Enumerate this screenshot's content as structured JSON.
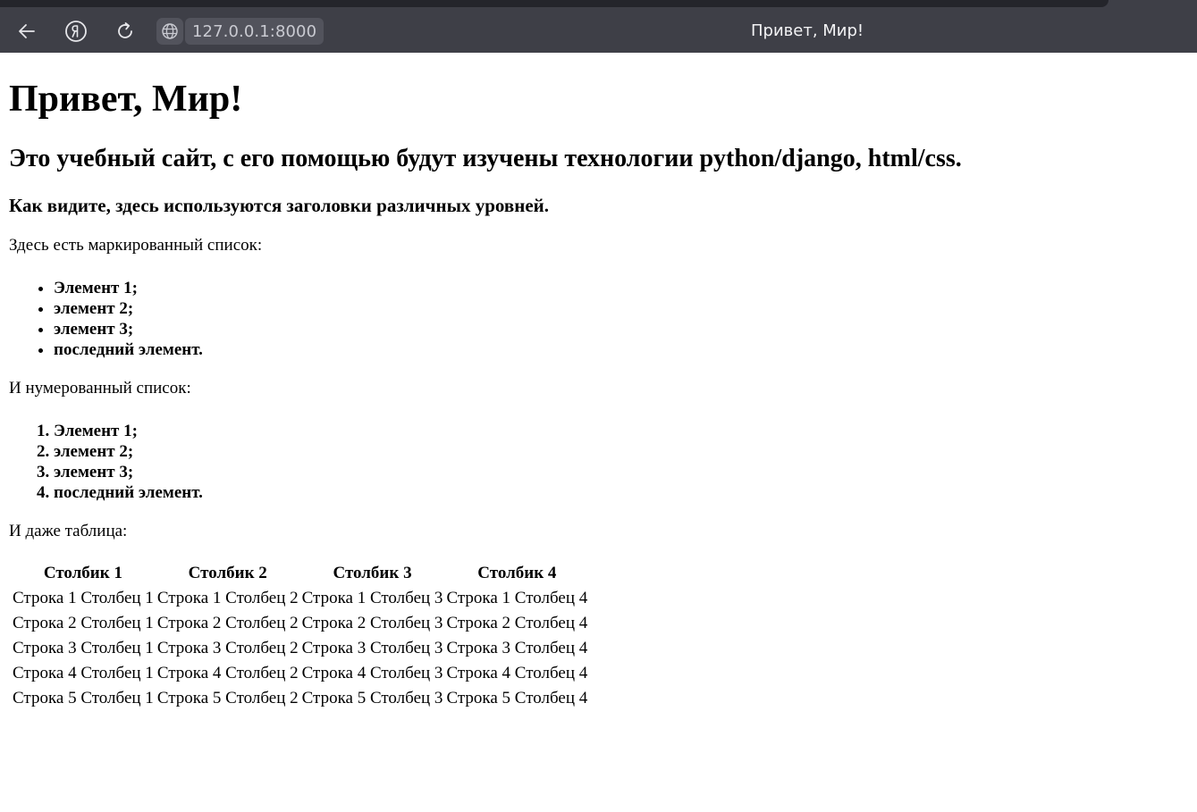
{
  "browser": {
    "url": "127.0.0.1:8000",
    "tab_title": "Привет, Мир!",
    "icons": [
      "back-arrow-icon",
      "yandex-icon",
      "reload-icon",
      "globe-icon"
    ]
  },
  "page": {
    "h1": "Привет, Мир!",
    "h2": "Это учебный сайт, с его помощью будут изучены технологии python/django, html/css.",
    "h3": "Как видите, здесь используются заголовки различных уровней.",
    "bullet_intro": "Здесь есть маркированный список:",
    "bullet_items": [
      "Элемент 1;",
      "элемент 2;",
      "элемент 3;",
      "последний элемент."
    ],
    "numbered_intro": "И нумерованный список:",
    "numbered_items": [
      "Элемент 1;",
      "элемент 2;",
      "элемент 3;",
      "последний элемент."
    ],
    "table_intro": "И даже таблица:",
    "table": {
      "headers": [
        "Столбик 1",
        "Столбик 2",
        "Столбик 3",
        "Столбик 4"
      ],
      "rows": [
        [
          "Строка 1 Столбец 1",
          "Строка 1 Столбец 2",
          "Строка 1 Столбец 3",
          "Строка 1 Столбец 4"
        ],
        [
          "Строка 2 Столбец 1",
          "Строка 2 Столбец 2",
          "Строка 2 Столбец 3",
          "Строка 2 Столбец 4"
        ],
        [
          "Строка 3 Столбец 1",
          "Строка 3 Столбец 2",
          "Строка 3 Столбец 3",
          "Строка 3 Столбец 4"
        ],
        [
          "Строка 4 Столбец 1",
          "Строка 4 Столбец 2",
          "Строка 4 Столбец 3",
          "Строка 4 Столбец 4"
        ],
        [
          "Строка 5 Столбец 1",
          "Строка 5 Столбец 2",
          "Строка 5 Столбец 3",
          "Строка 5 Столбец 4"
        ]
      ]
    }
  }
}
